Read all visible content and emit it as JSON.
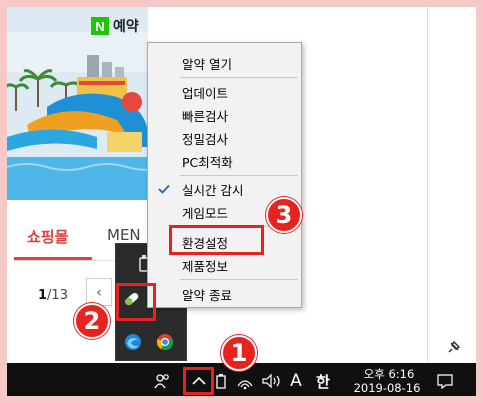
{
  "webpage": {
    "ad_badge_letter": "N",
    "ad_badge_text": "예약",
    "tabs": [
      {
        "label": "쇼핑몰",
        "active": true
      },
      {
        "label": "MEN",
        "active": false
      }
    ],
    "pager": {
      "current": "1",
      "total": "/13",
      "prev_glyph": "‹"
    }
  },
  "context_menu": {
    "items": [
      {
        "label": "알약 열기"
      },
      {
        "label": "업데이트"
      },
      {
        "label": "빠른검사"
      },
      {
        "label": "정밀검사"
      },
      {
        "label": "PC최적화"
      },
      {
        "label": "실시간 감시",
        "checked": true
      },
      {
        "label": "게임모드"
      },
      {
        "label": "환경설정",
        "highlighted": true
      },
      {
        "label": "제품정보"
      },
      {
        "label": "알약 종료"
      }
    ]
  },
  "taskbar": {
    "ime_mode": "A",
    "ime_lang": "한",
    "clock_time": "오후 6:16",
    "clock_date": "2019-08-16"
  },
  "annotations": {
    "step1": "1",
    "step2": "2",
    "step3": "3"
  },
  "colors": {
    "accent_red": "#e6231e",
    "alyac_green": "#8bc34a",
    "naver_green": "#1ec800"
  }
}
